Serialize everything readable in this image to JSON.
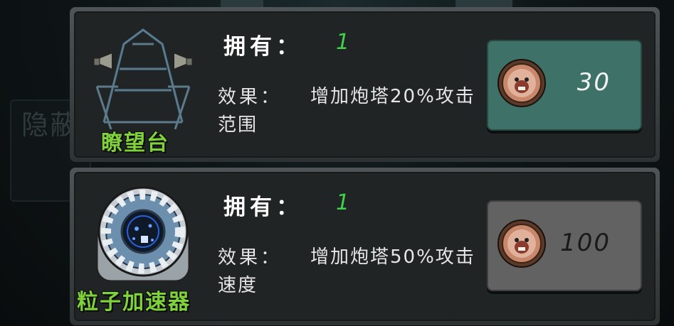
{
  "items": [
    {
      "name": "瞭望台",
      "owned_label": "拥有：",
      "owned_value": "1",
      "effect_label": "效果：",
      "effect_text": "增加炮塔20%攻击范围",
      "price": "30",
      "button_state": "active"
    },
    {
      "name": "粒子加速器",
      "owned_label": "拥有：",
      "owned_value": "1",
      "effect_label": "效果：",
      "effect_text": "增加炮塔50%攻击速度",
      "price": "100",
      "button_state": "disabled"
    }
  ],
  "background_text": "隐蔽"
}
